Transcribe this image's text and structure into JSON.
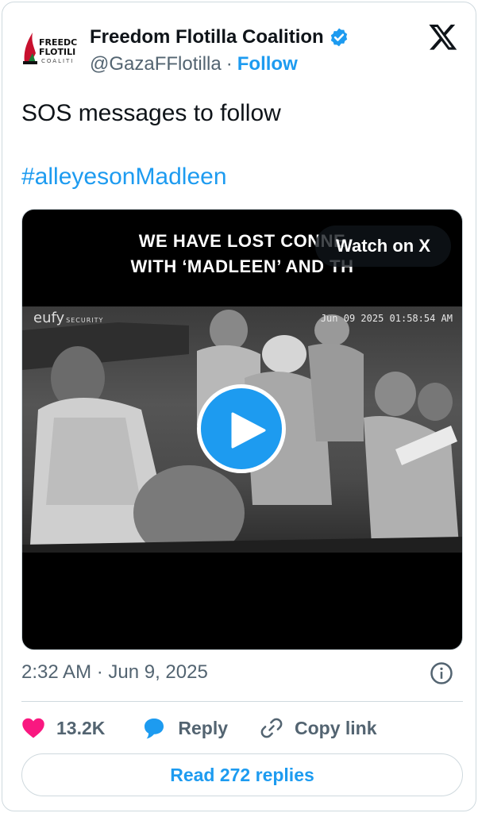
{
  "account": {
    "display_name": "Freedom Flotilla Coalition",
    "handle": "@GazaFFlotilla",
    "separator": "·",
    "follow_label": "Follow",
    "avatar_lines": [
      "FREEDC",
      "FLOTILI",
      "COALITI"
    ]
  },
  "tweet": {
    "text": "SOS messages to follow",
    "hashtag": "#alleyesonMadleen"
  },
  "media": {
    "caption_line1": "WE HAVE LOST CONNE",
    "caption_line2": "WITH ‘MADLEEN’ AND TH",
    "camera_brand": "eufy",
    "camera_brand_sub": "SECURITY",
    "camera_timestamp": "Jun 09 2025   01:58:54 AM",
    "watch_label": "Watch on X"
  },
  "meta": {
    "timestamp": "2:32 AM · Jun 9, 2025"
  },
  "actions": {
    "like_count": "13.2K",
    "reply_label": "Reply",
    "copy_label": "Copy link"
  },
  "read_replies_label": "Read 272 replies",
  "colors": {
    "accent": "#1d9bf0",
    "like": "#f91880",
    "text_primary": "#0f1419",
    "text_secondary": "#536471",
    "border": "#cfd9de"
  },
  "icons": [
    "verified-badge-icon",
    "x-logo-icon",
    "play-icon",
    "info-icon",
    "heart-icon",
    "reply-bubble-icon",
    "link-icon"
  ]
}
